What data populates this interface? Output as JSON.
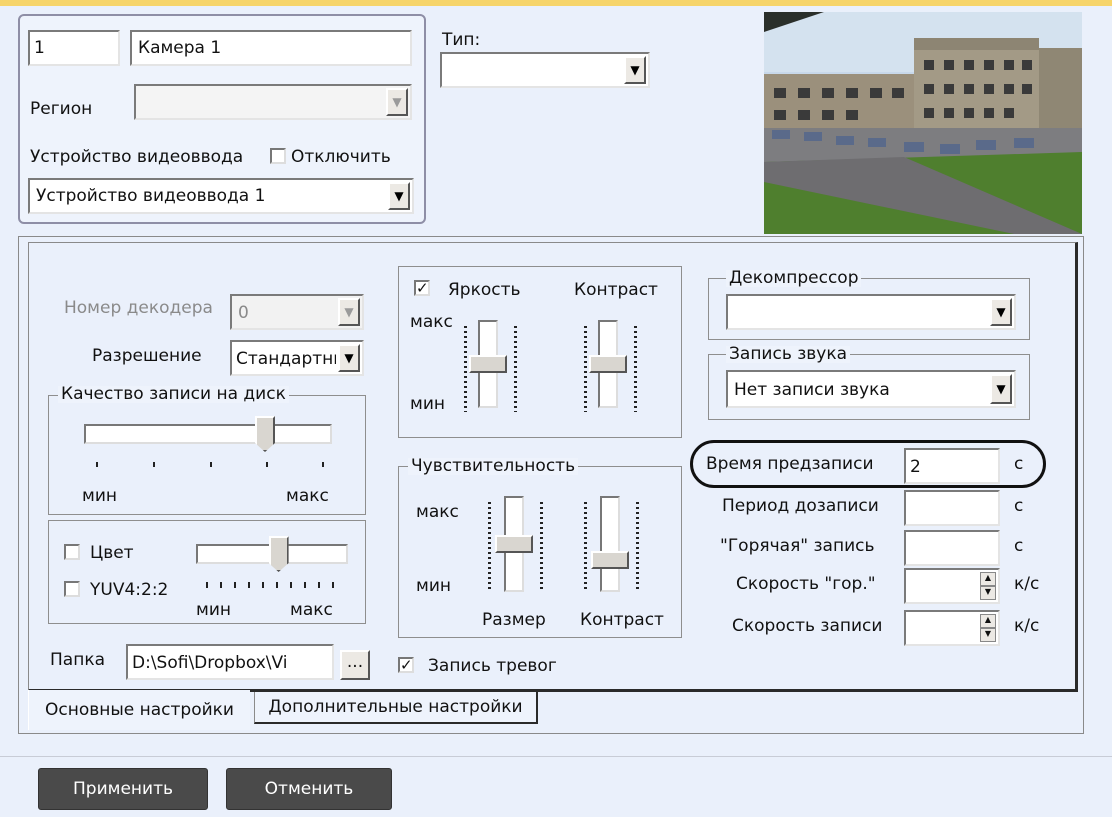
{
  "camera": {
    "id": "1",
    "name": "Камера 1",
    "region_label": "Регион",
    "region_value": "",
    "type_label": "Тип:",
    "type_value": "",
    "video_input_label": "Устройство видеоввода",
    "disable_label": "Отключить",
    "disable_checked": false,
    "video_input_value": "Устройство видеоввода 1"
  },
  "basic": {
    "decoder_number_label": "Номер декодера",
    "decoder_number_value": "0",
    "resolution_label": "Разрешение",
    "resolution_value": "Стандартный",
    "disk_quality_label": "Качество записи на диск",
    "disk_quality_level": 0.75,
    "min_label": "мин",
    "max_label": "макс",
    "color_label": "Цвет",
    "color_checked": false,
    "yuv_label": "YUV4:2:2",
    "yuv_checked": false,
    "color_level": 0.55,
    "color_min_label": "мин",
    "color_max_label": "макс",
    "folder_label": "Папка",
    "folder_value": "D:\\Sofi\\Dropbox\\Vi",
    "browse_label": "...",
    "brightness_label": "Яркость",
    "brightness_checked": true,
    "contrast_label": "Контраст",
    "bc_max_label": "макс",
    "bc_min_label": "мин",
    "brightness_level": 0.5,
    "contrast_level": 0.5,
    "sensitivity_label": "Чувствительность",
    "sens_max_label": "макс",
    "sens_min_label": "мин",
    "size_label": "Размер",
    "sens_contrast_label": "Контраст",
    "size_level": 0.5,
    "sens_contrast_level": 0.3,
    "alarm_record_label": "Запись тревог",
    "alarm_record_checked": true,
    "decompressor_label": "Декомпрессор",
    "decompressor_value": "",
    "audio_label": "Запись звука",
    "audio_value": "Нет записи звука",
    "prerecord_label": "Время предзаписи",
    "prerecord_value": "2",
    "prerecord_unit": "с",
    "postrecord_label": "Период дозаписи",
    "postrecord_value": "",
    "postrecord_unit": "с",
    "hot_label": "\"Горячая\" запись",
    "hot_value": "",
    "hot_unit": "с",
    "hot_speed_label": "Скорость \"гор.\"",
    "hot_speed_value": "",
    "hot_speed_unit": "к/с",
    "rec_speed_label": "Скорость записи",
    "rec_speed_value": "",
    "rec_speed_unit": "к/с"
  },
  "tabs": [
    "Основные настройки",
    "Дополнительные настройки"
  ],
  "buttons": {
    "apply": "Применить",
    "cancel": "Отменить"
  }
}
